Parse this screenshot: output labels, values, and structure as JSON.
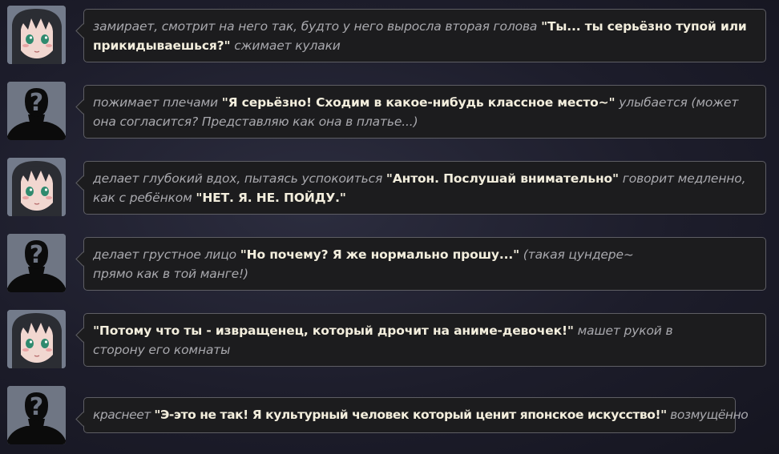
{
  "colors": {
    "background": "#22232f",
    "bubble_bg": "#1c1c1e",
    "bubble_border": "#5e5e64",
    "action_text": "#a9a9ae",
    "speech_text": "#f3eedd"
  },
  "messages": [
    {
      "author": "girl",
      "avatar_icon": "anime-girl-avatar",
      "segments": [
        {
          "type": "action",
          "text": "замирает, смотрит на него так, будто у него выросла вторая голова "
        },
        {
          "type": "speech",
          "text": "\"Ты... ты серьёзно тупой или прикидываешься?\""
        },
        {
          "type": "action",
          "text": " сжимает кулаки"
        }
      ]
    },
    {
      "author": "user",
      "avatar_icon": "unknown-user-silhouette-icon",
      "segments": [
        {
          "type": "action",
          "text": "пожимает плечами "
        },
        {
          "type": "speech",
          "text": "\"Я серьёзно! Сходим в какое-нибудь классное место~\""
        },
        {
          "type": "action",
          "text": " улыбается (может она согласится? Представляю как она в платье...)"
        }
      ]
    },
    {
      "author": "girl",
      "avatar_icon": "anime-girl-avatar",
      "segments": [
        {
          "type": "action",
          "text": "делает глубокий вдох, пытаясь успокоиться "
        },
        {
          "type": "speech",
          "text": "\"Антон. Послушай внимательно\""
        },
        {
          "type": "action",
          "text": " говорит медленно, как с ребёнком "
        },
        {
          "type": "speech",
          "text": "\"НЕТ. Я. НЕ. ПОЙДУ.\""
        }
      ]
    },
    {
      "author": "user",
      "avatar_icon": "unknown-user-silhouette-icon",
      "segments": [
        {
          "type": "action",
          "text": "делает грустное лицо "
        },
        {
          "type": "speech",
          "text": "\"Но почему? Я же нормально прошу...\""
        },
        {
          "type": "action",
          "text": " (такая цундере~ прямо как в той манге!)"
        }
      ]
    },
    {
      "author": "girl",
      "avatar_icon": "anime-girl-avatar",
      "segments": [
        {
          "type": "speech",
          "text": "\"Потому что ты - извращенец, который дрочит на аниме-девочек!\""
        },
        {
          "type": "action",
          "text": " машет рукой в сторону его комнаты"
        }
      ]
    },
    {
      "author": "user",
      "avatar_icon": "unknown-user-silhouette-icon",
      "segments": [
        {
          "type": "action",
          "text": "краснеет "
        },
        {
          "type": "speech",
          "text": "\"Э-это не так! Я культурный человек который ценит японское искусство!\""
        },
        {
          "type": "action",
          "text": " возмущённо"
        }
      ]
    }
  ]
}
